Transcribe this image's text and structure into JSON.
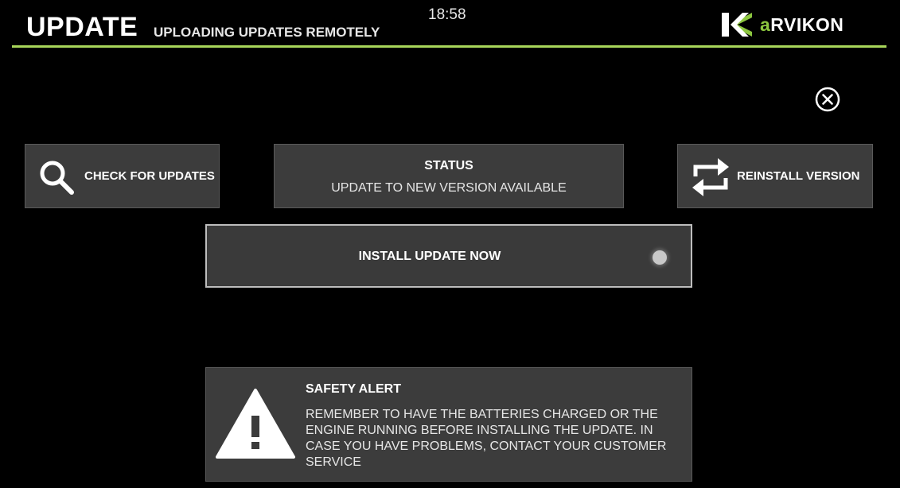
{
  "header": {
    "title": "UPDATE",
    "subtitle": "UPLOADING UPDATES REMOTELY",
    "time": "18:58",
    "brand": {
      "accent_letter": "a",
      "name_rest": "RVIKON"
    },
    "accent_color": "#a8d65a"
  },
  "close": {
    "icon": "close-circle-icon"
  },
  "check_updates": {
    "label": "CHECK FOR UPDATES",
    "icon": "search-icon"
  },
  "status": {
    "heading": "STATUS",
    "value": "UPDATE TO NEW VERSION AVAILABLE"
  },
  "reinstall": {
    "label": "REINSTALL VERSION",
    "icon": "swap-arrows-icon"
  },
  "install": {
    "label": "INSTALL UPDATE NOW",
    "indicator_color": "#c8c8c8"
  },
  "safety_alert": {
    "heading": "SAFETY ALERT",
    "message": "REMEMBER TO HAVE THE BATTERIES CHARGED OR THE ENGINE RUNNING BEFORE INSTALLING THE UPDATE. IN CASE YOU HAVE PROBLEMS, CONTACT YOUR CUSTOMER SERVICE",
    "icon": "warning-triangle-icon"
  }
}
